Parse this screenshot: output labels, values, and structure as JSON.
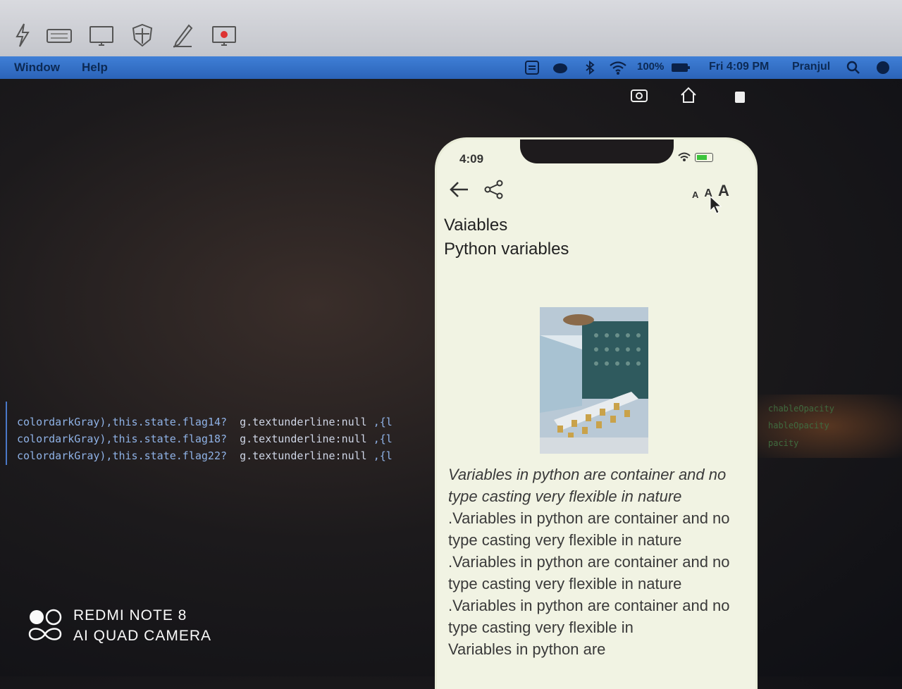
{
  "menubar": {
    "items": [
      "Window",
      "Help"
    ],
    "battery_label": "100%",
    "clock": "Fri 4:09 PM",
    "user": "Pranjul"
  },
  "editor": {
    "lines": [
      {
        "a": "colordarkGray),this.state.flag14?",
        "b": "g.textunderline:null",
        "c": " ,{l"
      },
      {
        "a": "colordarkGray),this.state.flag18?",
        "b": "g.textunderline:null",
        "c": " ,{l"
      },
      {
        "a": "colordarkGray),this.state.flag22?",
        "b": "g.textunderline:null",
        "c": " ,{l"
      }
    ],
    "right_lines": [
      "chableOpacity",
      "hableOpacity",
      "pacity"
    ]
  },
  "phone": {
    "time": "4:09",
    "font_sizes": [
      "A",
      "A",
      "A"
    ],
    "title": "Vaiables",
    "subtitle": "Python variables",
    "body_italic": "Variables in python are container and no type casting very flexible in nature",
    "body_rest": " .Variables in python are container and no type casting very flexible in nature .Variables in python are container and no type casting very flexible in nature .Variables in python are container and no type casting very flexible in",
    "body_tail": "Variables in python are"
  },
  "watermark": {
    "line1": "REDMI NOTE 8",
    "line2": "AI QUAD CAMERA"
  },
  "icons": [
    "lightning-icon",
    "keyboard-icon",
    "monitor-icon",
    "shield-icon",
    "pen-icon",
    "record-screen-icon",
    "screenshot-icon",
    "home-icon",
    "rotate-icon",
    "back-arrow-icon",
    "share-icon",
    "wifi-icon",
    "search-icon"
  ]
}
